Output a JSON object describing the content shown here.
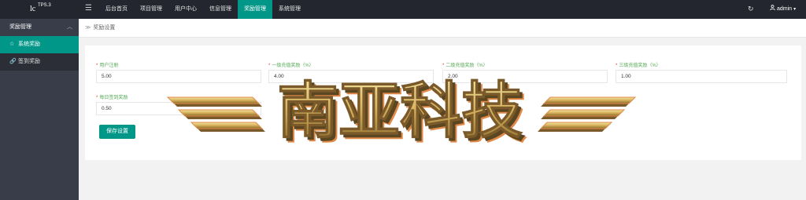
{
  "app": {
    "logo_main": "lc",
    "logo_sup": "TPS.3"
  },
  "topnav": [
    {
      "label": "后台首页"
    },
    {
      "label": "项目管理"
    },
    {
      "label": "用户中心"
    },
    {
      "label": "信息管理"
    },
    {
      "label": "奖励管理",
      "active": true
    },
    {
      "label": "系统管理"
    }
  ],
  "user": {
    "name": "admin"
  },
  "sidebar": {
    "group_label": "奖励管理",
    "items": [
      {
        "label": "系统奖励",
        "active": true,
        "icon": "star-icon"
      },
      {
        "label": "签到奖励",
        "active": false,
        "icon": "link-icon"
      }
    ]
  },
  "breadcrumb": {
    "label": "奖励设置"
  },
  "form": {
    "fields": [
      {
        "label": "用户注册",
        "value": "5.00"
      },
      {
        "label": "一级充值奖励（%）",
        "value": "4.00"
      },
      {
        "label": "二级充值奖励（%）",
        "value": "2.00"
      },
      {
        "label": "三级充值奖励（%）",
        "value": "1.00"
      },
      {
        "label": "每日签到奖励",
        "value": "0.50"
      }
    ],
    "save_label": "保存设置"
  },
  "watermark": {
    "text": "南亚科技"
  },
  "colors": {
    "accent": "#009688",
    "topbar": "#23262e",
    "sidebar": "#393d49",
    "required": "#ee3333",
    "label": "#55aa55"
  }
}
